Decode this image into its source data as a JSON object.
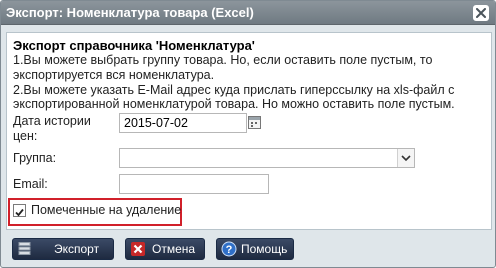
{
  "dialog": {
    "title": "Экспорт: Номенклатура товара (Excel)"
  },
  "panel": {
    "heading": "Экспорт справочника 'Номенклатура'",
    "desc_line1": "1.Вы можете выбрать группу товара. Но, если оставить поле пустым, то",
    "desc_line2": "экспортируется вся номенклатура.",
    "desc_line3": "2.Вы можете указать E-Mail адрес куда прислать гиперссылку на xls-файл с",
    "desc_line4": "экспортированной номенклатурой товара. Но можно оставить поле пустым."
  },
  "form": {
    "date_label_1": "Дата истории",
    "date_label_2": "цен:",
    "date_value": "2015-07-02",
    "group_label": "Группа:",
    "group_value": "",
    "email_label": "Email:",
    "email_value": "",
    "deleted_label": "Помеченные на удаление",
    "deleted_checked": true
  },
  "buttons": {
    "export": "Экспорт",
    "cancel": "Отмена",
    "help": "Помощь"
  },
  "colors": {
    "highlight": "#d1202a",
    "button_bg": "#26334d"
  }
}
